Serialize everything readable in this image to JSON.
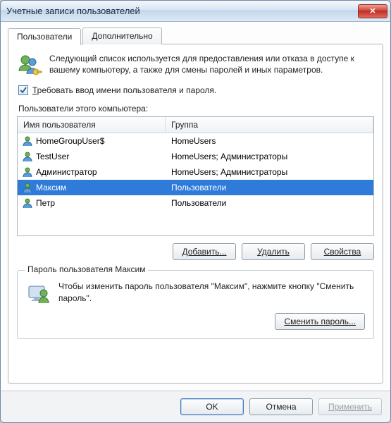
{
  "window": {
    "title": "Учетные записи пользователей"
  },
  "tabs": {
    "users": "Пользователи",
    "advanced": "Дополнительно"
  },
  "intro": {
    "text": "Следующий список используется для предоставления или отказа в доступе к вашему компьютеру, а также для смены паролей и иных параметров."
  },
  "checkbox": {
    "prefix": "Т",
    "rest": "ребовать ввод имени пользователя и пароля.",
    "checked": true
  },
  "list": {
    "label": "Пользователи этого компьютера:",
    "col_name": "Имя пользователя",
    "col_group": "Группа",
    "rows": [
      {
        "name": "HomeGroupUser$",
        "group": "HomeUsers",
        "selected": false
      },
      {
        "name": "TestUser",
        "group": "HomeUsers; Администраторы",
        "selected": false
      },
      {
        "name": "Администратор",
        "group": "HomeUsers; Администраторы",
        "selected": false
      },
      {
        "name": "Максим",
        "group": "Пользователи",
        "selected": true
      },
      {
        "name": "Петр",
        "group": "Пользователи",
        "selected": false
      }
    ]
  },
  "buttons": {
    "add": "Добавить...",
    "remove": "Удалить",
    "properties": "Свойства"
  },
  "password_box": {
    "title": "Пароль пользователя Максим",
    "text": "Чтобы изменить пароль пользователя \"Максим\", нажмите кнопку \"Сменить пароль\".",
    "change": "Сменить пароль..."
  },
  "bottom": {
    "ok": "OK",
    "cancel": "Отмена",
    "apply": "Применить"
  }
}
